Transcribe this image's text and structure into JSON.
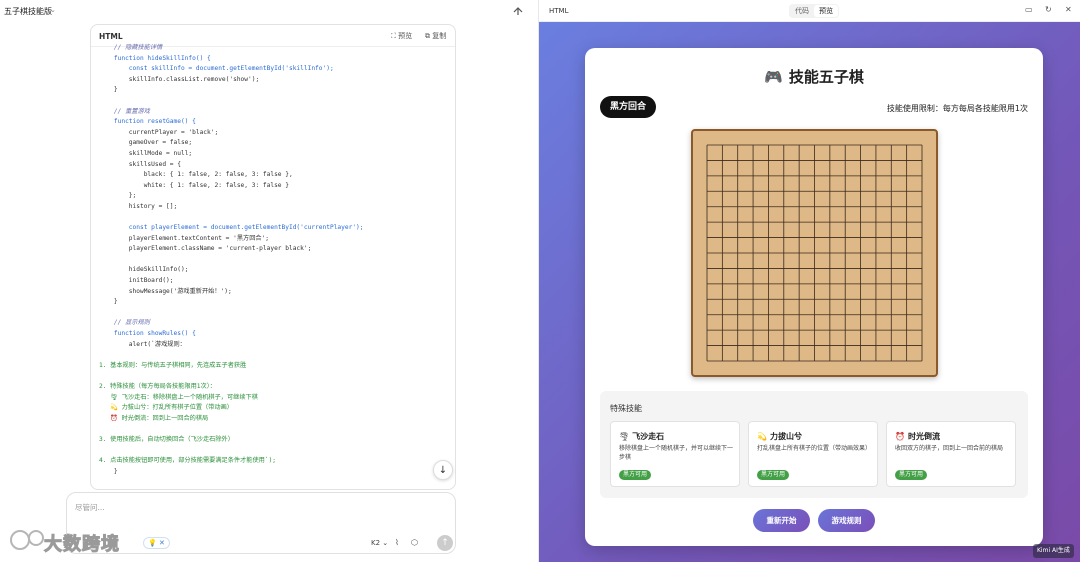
{
  "left": {
    "app_title": "五子棋技能版",
    "code_card": {
      "lang": "HTML",
      "preview_label": "预览",
      "copy_label": "复制"
    },
    "code_lines": [
      "    // 隐藏技能详情",
      "    function hideSkillInfo() {",
      "        const skillInfo = document.getElementById('skillInfo');",
      "        skillInfo.classList.remove('show');",
      "    }",
      "",
      "    // 重置游戏",
      "    function resetGame() {",
      "        currentPlayer = 'black';",
      "        gameOver = false;",
      "        skillMode = null;",
      "        skillsUsed = {",
      "            black: { 1: false, 2: false, 3: false },",
      "            white: { 1: false, 2: false, 3: false }",
      "        };",
      "        history = [];",
      "",
      "        const playerElement = document.getElementById('currentPlayer');",
      "        playerElement.textContent = '黑方回合';",
      "        playerElement.className = 'current-player black';",
      "",
      "        hideSkillInfo();",
      "        initBoard();",
      "        showMessage('游戏重新开始！');",
      "    }",
      "",
      "    // 显示规则",
      "    function showRules() {",
      "        alert(`游戏规则：",
      "",
      "1. 基本规则：与传统五子棋相同，先连成五子者获胜",
      "",
      "2. 特殊技能（每方每局各技能限用1次）：",
      "   🌪 飞沙走石：移除棋盘上一个随机棋子，可继续下棋",
      "   💫 力拔山兮：打乱所有棋子位置（带动画）",
      "   ⏰ 时光倒流：回到上一回合的棋局",
      "",
      "3. 使用技能后，自动切换回合（飞沙走石除外）",
      "",
      "4. 点击技能按钮即可使用，部分技能需要满足条件才能使用`);",
      "    }"
    ],
    "input": {
      "placeholder": "尽管问...",
      "chip_label": "✕",
      "model": "K2"
    },
    "watermark": "大数跨境"
  },
  "right": {
    "lang": "HTML",
    "tabs": [
      {
        "label": "代码",
        "active": false
      },
      {
        "label": "预览",
        "active": true
      }
    ],
    "game": {
      "title": "技能五子棋",
      "current_player": "黑方回合",
      "limit_text": "技能使用限制：每方每局各技能限用1次",
      "board_lines": 15,
      "skills_heading": "特殊技能",
      "skills": [
        {
          "icon": "🌪",
          "name": "飞沙走石",
          "desc": "移除棋盘上一个随机棋子，并可以继续下一步棋",
          "status": "黑方可用"
        },
        {
          "icon": "💫",
          "name": "力拔山兮",
          "desc": "打乱棋盘上所有棋子的位置（带动画效果）",
          "status": "黑方可用"
        },
        {
          "icon": "⏰",
          "name": "时光倒流",
          "desc": "收回双方的棋子，回到上一回合前的棋局",
          "status": "黑方可用"
        }
      ],
      "restart_label": "重新开始",
      "rules_label": "游戏规则"
    },
    "kimi_tag": "Kimi AI生成"
  },
  "colors": {
    "board": "#deb887",
    "board_border": "#8b5a2b",
    "gradient_start": "#6a7fe0",
    "gradient_end": "#7a4aa8",
    "skill_badge": "#43a047"
  },
  "icons": {
    "share": "share-icon",
    "preview": "expand-icon",
    "copy": "copy-icon",
    "attach": "paperclip-icon",
    "cube": "cube-icon",
    "send": "arrow-up-icon",
    "gamepad": "gamepad-icon"
  }
}
